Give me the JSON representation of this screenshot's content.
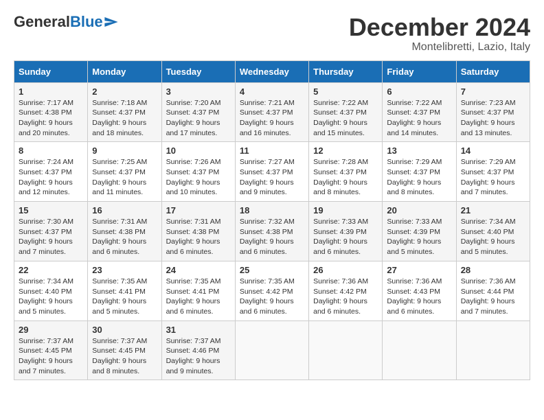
{
  "header": {
    "logo_general": "General",
    "logo_blue": "Blue",
    "month_title": "December 2024",
    "location": "Montelibretti, Lazio, Italy"
  },
  "days_of_week": [
    "Sunday",
    "Monday",
    "Tuesday",
    "Wednesday",
    "Thursday",
    "Friday",
    "Saturday"
  ],
  "weeks": [
    [
      {
        "day": "1",
        "sunrise": "7:17 AM",
        "sunset": "4:38 PM",
        "daylight": "9 hours and 20 minutes."
      },
      {
        "day": "2",
        "sunrise": "7:18 AM",
        "sunset": "4:37 PM",
        "daylight": "9 hours and 18 minutes."
      },
      {
        "day": "3",
        "sunrise": "7:20 AM",
        "sunset": "4:37 PM",
        "daylight": "9 hours and 17 minutes."
      },
      {
        "day": "4",
        "sunrise": "7:21 AM",
        "sunset": "4:37 PM",
        "daylight": "9 hours and 16 minutes."
      },
      {
        "day": "5",
        "sunrise": "7:22 AM",
        "sunset": "4:37 PM",
        "daylight": "9 hours and 15 minutes."
      },
      {
        "day": "6",
        "sunrise": "7:22 AM",
        "sunset": "4:37 PM",
        "daylight": "9 hours and 14 minutes."
      },
      {
        "day": "7",
        "sunrise": "7:23 AM",
        "sunset": "4:37 PM",
        "daylight": "9 hours and 13 minutes."
      }
    ],
    [
      {
        "day": "8",
        "sunrise": "7:24 AM",
        "sunset": "4:37 PM",
        "daylight": "9 hours and 12 minutes."
      },
      {
        "day": "9",
        "sunrise": "7:25 AM",
        "sunset": "4:37 PM",
        "daylight": "9 hours and 11 minutes."
      },
      {
        "day": "10",
        "sunrise": "7:26 AM",
        "sunset": "4:37 PM",
        "daylight": "9 hours and 10 minutes."
      },
      {
        "day": "11",
        "sunrise": "7:27 AM",
        "sunset": "4:37 PM",
        "daylight": "9 hours and 9 minutes."
      },
      {
        "day": "12",
        "sunrise": "7:28 AM",
        "sunset": "4:37 PM",
        "daylight": "9 hours and 8 minutes."
      },
      {
        "day": "13",
        "sunrise": "7:29 AM",
        "sunset": "4:37 PM",
        "daylight": "9 hours and 8 minutes."
      },
      {
        "day": "14",
        "sunrise": "7:29 AM",
        "sunset": "4:37 PM",
        "daylight": "9 hours and 7 minutes."
      }
    ],
    [
      {
        "day": "15",
        "sunrise": "7:30 AM",
        "sunset": "4:37 PM",
        "daylight": "9 hours and 7 minutes."
      },
      {
        "day": "16",
        "sunrise": "7:31 AM",
        "sunset": "4:38 PM",
        "daylight": "9 hours and 6 minutes."
      },
      {
        "day": "17",
        "sunrise": "7:31 AM",
        "sunset": "4:38 PM",
        "daylight": "9 hours and 6 minutes."
      },
      {
        "day": "18",
        "sunrise": "7:32 AM",
        "sunset": "4:38 PM",
        "daylight": "9 hours and 6 minutes."
      },
      {
        "day": "19",
        "sunrise": "7:33 AM",
        "sunset": "4:39 PM",
        "daylight": "9 hours and 6 minutes."
      },
      {
        "day": "20",
        "sunrise": "7:33 AM",
        "sunset": "4:39 PM",
        "daylight": "9 hours and 5 minutes."
      },
      {
        "day": "21",
        "sunrise": "7:34 AM",
        "sunset": "4:40 PM",
        "daylight": "9 hours and 5 minutes."
      }
    ],
    [
      {
        "day": "22",
        "sunrise": "7:34 AM",
        "sunset": "4:40 PM",
        "daylight": "9 hours and 5 minutes."
      },
      {
        "day": "23",
        "sunrise": "7:35 AM",
        "sunset": "4:41 PM",
        "daylight": "9 hours and 5 minutes."
      },
      {
        "day": "24",
        "sunrise": "7:35 AM",
        "sunset": "4:41 PM",
        "daylight": "9 hours and 6 minutes."
      },
      {
        "day": "25",
        "sunrise": "7:35 AM",
        "sunset": "4:42 PM",
        "daylight": "9 hours and 6 minutes."
      },
      {
        "day": "26",
        "sunrise": "7:36 AM",
        "sunset": "4:42 PM",
        "daylight": "9 hours and 6 minutes."
      },
      {
        "day": "27",
        "sunrise": "7:36 AM",
        "sunset": "4:43 PM",
        "daylight": "9 hours and 6 minutes."
      },
      {
        "day": "28",
        "sunrise": "7:36 AM",
        "sunset": "4:44 PM",
        "daylight": "9 hours and 7 minutes."
      }
    ],
    [
      {
        "day": "29",
        "sunrise": "7:37 AM",
        "sunset": "4:45 PM",
        "daylight": "9 hours and 7 minutes."
      },
      {
        "day": "30",
        "sunrise": "7:37 AM",
        "sunset": "4:45 PM",
        "daylight": "9 hours and 8 minutes."
      },
      {
        "day": "31",
        "sunrise": "7:37 AM",
        "sunset": "4:46 PM",
        "daylight": "9 hours and 9 minutes."
      },
      null,
      null,
      null,
      null
    ]
  ],
  "labels": {
    "sunrise": "Sunrise:",
    "sunset": "Sunset:",
    "daylight": "Daylight:"
  }
}
